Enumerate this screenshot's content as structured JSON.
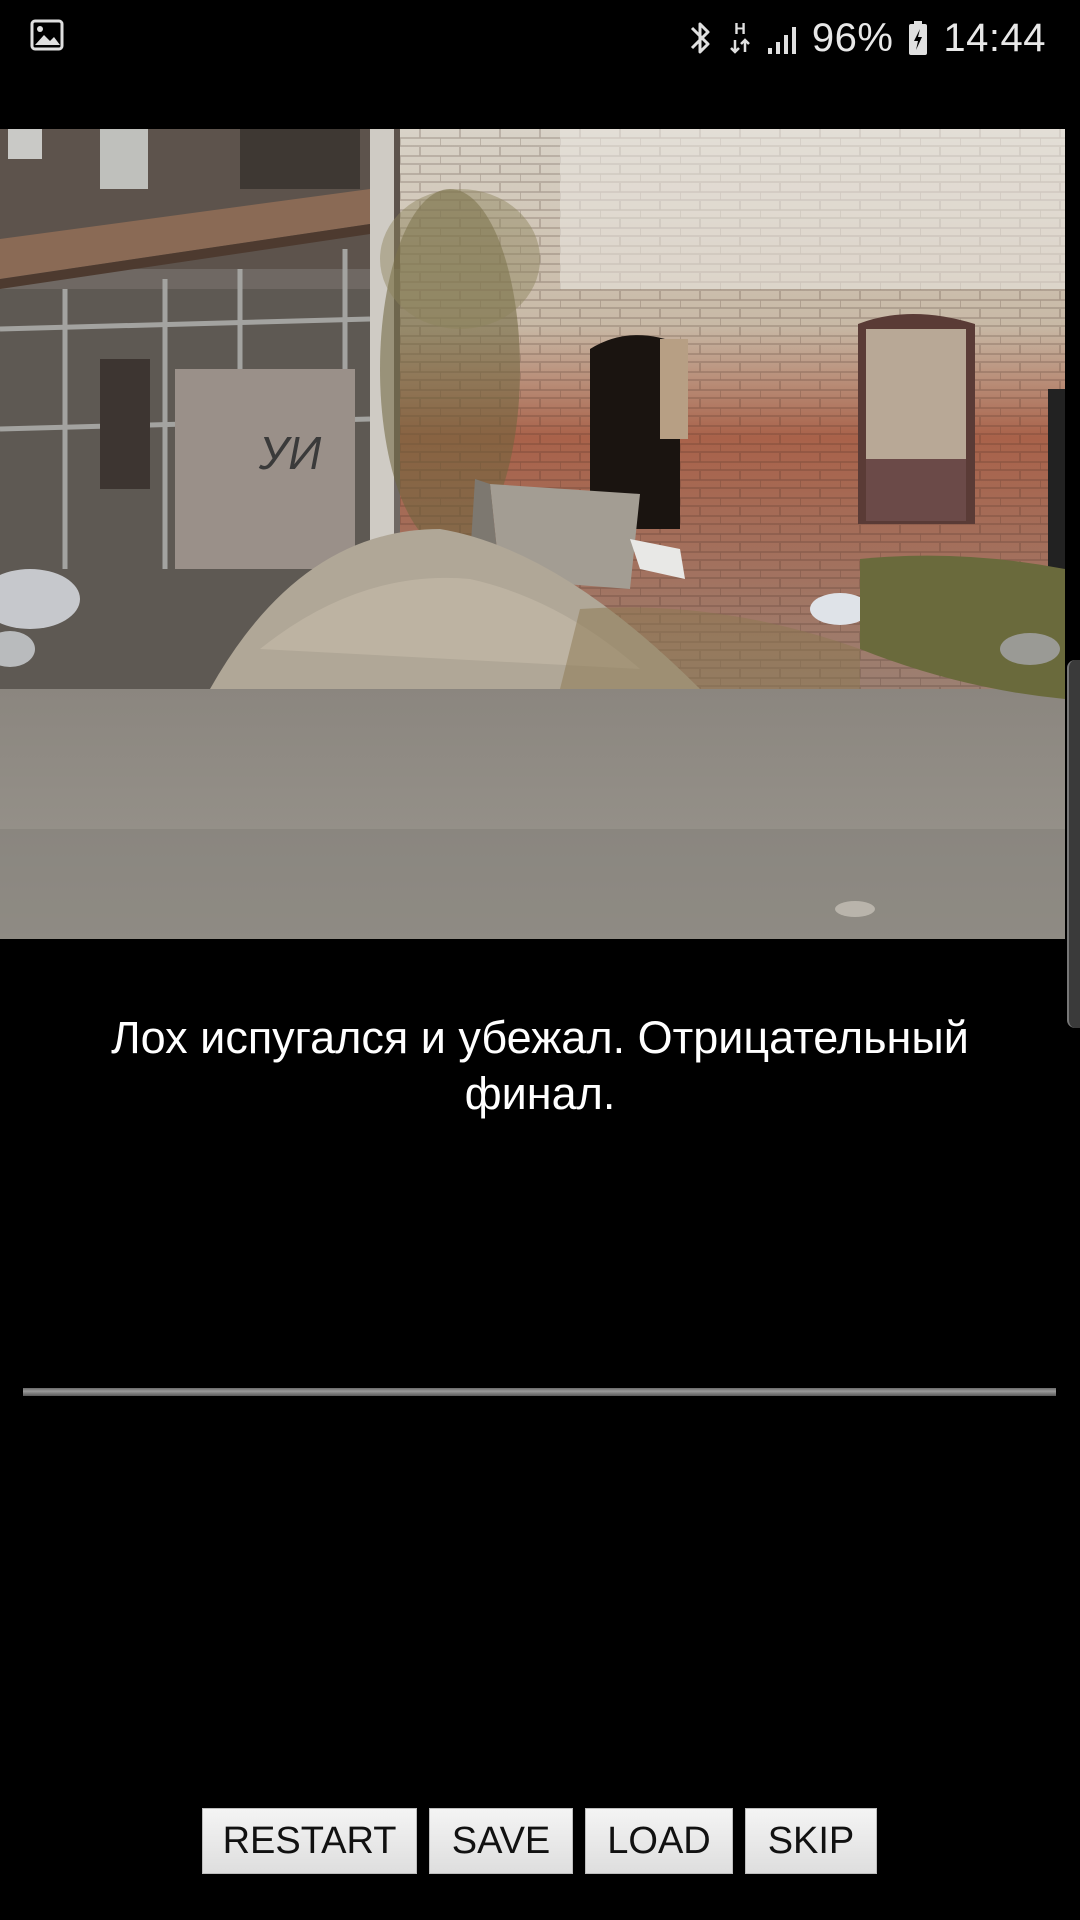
{
  "status_bar": {
    "left_icon": "gallery-icon",
    "icons": [
      "bluetooth-icon",
      "network-h-icon",
      "signal-icon"
    ],
    "battery_percent": "96%",
    "battery_icon": "battery-charging-icon",
    "time": "14:44"
  },
  "scene": {
    "graffiti": "УИ"
  },
  "story": {
    "text": "Лох испугался и убежал. Отрицательный финал."
  },
  "buttons": {
    "restart": "RESTART",
    "save": "SAVE",
    "load": "LOAD",
    "skip": "SKIP"
  },
  "colors": {
    "background": "#000000",
    "text": "#ffffff",
    "button_bg": "#e9e9e9",
    "button_text": "#111111"
  }
}
